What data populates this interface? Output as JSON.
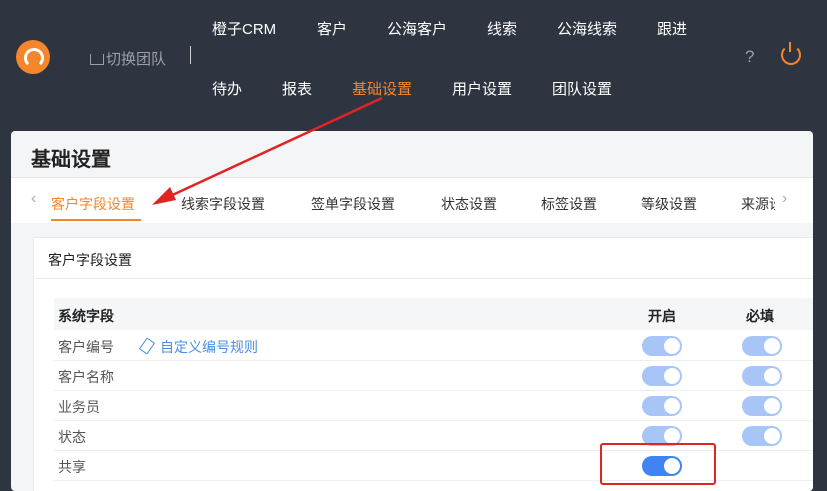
{
  "header": {
    "switch_team": "切换团队",
    "nav_row1": [
      "橙子CRM",
      "客户",
      "公海客户",
      "线索",
      "公海线索",
      "跟进"
    ],
    "nav_row2": [
      "待办",
      "报表",
      "基础设置",
      "用户设置",
      "团队设置"
    ],
    "active_nav": "基础设置",
    "help": "?"
  },
  "page": {
    "title": "基础设置",
    "tabs": [
      "客户字段设置",
      "线索字段设置",
      "签单字段设置",
      "状态设置",
      "标签设置",
      "等级设置",
      "来源设"
    ],
    "active_tab": "客户字段设置"
  },
  "section": {
    "title": "客户字段设置",
    "columns": [
      "系统字段",
      "开启",
      "必填"
    ],
    "rows": [
      {
        "label": "客户编号",
        "link": "自定义编号规则",
        "enabled": true,
        "required": true
      },
      {
        "label": "客户名称",
        "enabled": true,
        "required": true
      },
      {
        "label": "业务员",
        "enabled": true,
        "required": true
      },
      {
        "label": "状态",
        "enabled": true,
        "required": true
      },
      {
        "label": "共享",
        "enabled": true,
        "required": null
      }
    ]
  },
  "colors": {
    "accent": "#f5862b",
    "toggle_on": "#a7c6f7",
    "toggle_active": "#3f84f2",
    "annotation": "#e02424"
  }
}
